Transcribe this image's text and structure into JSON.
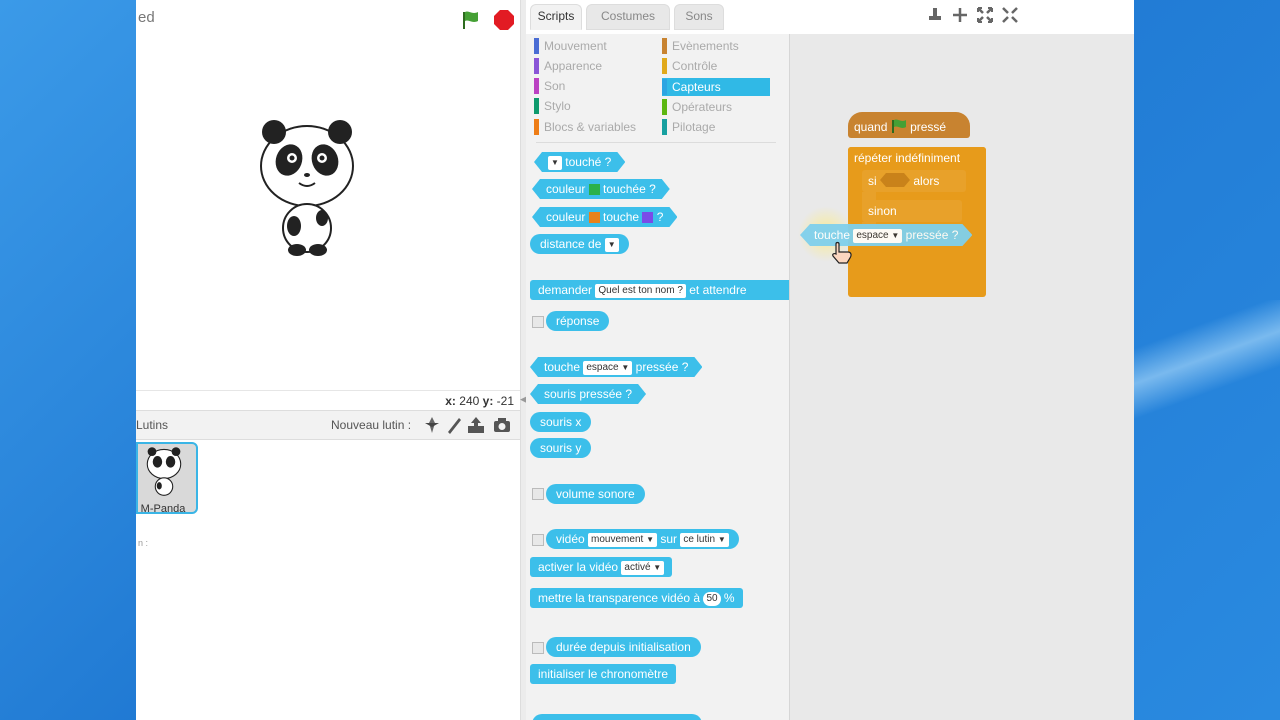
{
  "stage": {
    "title_fragment": "ed",
    "coords": {
      "x_label": "x:",
      "x": "240",
      "y_label": "y:",
      "y": "-21"
    }
  },
  "sprites": {
    "label": "Lutins",
    "new_sprite_label": "Nouveau lutin :",
    "list": [
      {
        "name": "M-Panda"
      }
    ],
    "info_fragment": "n :"
  },
  "tabs": [
    {
      "label": "Scripts",
      "active": true
    },
    {
      "label": "Costumes",
      "active": false
    },
    {
      "label": "Sons",
      "active": false
    }
  ],
  "categories": [
    {
      "label": "Mouvement",
      "color": "#4a6cd4"
    },
    {
      "label": "Apparence",
      "color": "#8a55d7"
    },
    {
      "label": "Son",
      "color": "#bb42c3"
    },
    {
      "label": "Stylo",
      "color": "#0e9a6c"
    },
    {
      "label": "Blocs & variables",
      "color": "#ee7d16"
    },
    {
      "label": "Evènements",
      "color": "#c88330"
    },
    {
      "label": "Contrôle",
      "color": "#e1a91a"
    },
    {
      "label": "Capteurs",
      "color": "#2ca5e2",
      "active": true
    },
    {
      "label": "Opérateurs",
      "color": "#5cb712"
    },
    {
      "label": "Pilotage",
      "color": "#17a0a0"
    }
  ],
  "palette": {
    "touching": {
      "label": "touché ?"
    },
    "touching_color": {
      "label": "couleur",
      "label2": "touchée ?"
    },
    "color_touching": {
      "label": "couleur",
      "label2": "touche",
      "label3": "?"
    },
    "distance": {
      "label": "distance de"
    },
    "ask": {
      "label": "demander",
      "input": "Quel est ton nom ?",
      "label2": "et attendre"
    },
    "answer": {
      "label": "réponse"
    },
    "key_pressed": {
      "label": "touche",
      "input": "espace",
      "label2": "pressée ?"
    },
    "mouse_down": {
      "label": "souris pressée ?"
    },
    "mouse_x": {
      "label": "souris x"
    },
    "mouse_y": {
      "label": "souris y"
    },
    "loudness": {
      "label": "volume sonore"
    },
    "video_motion": {
      "label": "vidéo",
      "input": "mouvement",
      "label2": "sur",
      "input2": "ce lutin"
    },
    "video_toggle": {
      "label": "activer la vidéo",
      "input": "activé"
    },
    "video_transparency": {
      "label": "mettre la transparence vidéo à",
      "input": "50",
      "label2": "%"
    },
    "timer": {
      "label": "durée depuis initialisation"
    },
    "reset_timer": {
      "label": "initialiser le chronomètre"
    }
  },
  "script": {
    "when_flag": {
      "label": "quand",
      "label2": "pressé"
    },
    "forever": {
      "label": "répéter indéfiniment"
    },
    "if": {
      "label": "si",
      "label2": "alors"
    },
    "else": {
      "label": "sinon"
    },
    "dragged": {
      "label": "touche",
      "input": "espace",
      "label2": "pressée ?"
    }
  },
  "colors": {
    "sensing": "#3cbfea",
    "control": "#e79b1b",
    "events": "#c88330",
    "active_category": "#30b9e6"
  }
}
